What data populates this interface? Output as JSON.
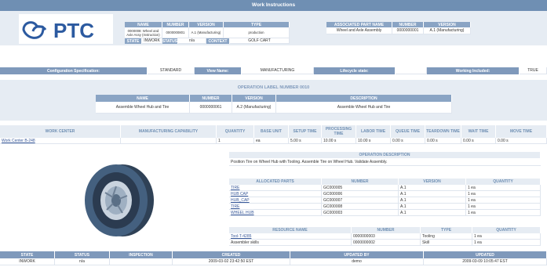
{
  "page_title": "Work Instructions",
  "logo_text": "PTC",
  "header_table": {
    "columns": [
      "NAME",
      "NUMBER",
      "VERSION",
      "TYPE"
    ],
    "row": [
      "0000008: Wheel and Axle Assy (Instruction)",
      "0000000801",
      "A.1 (Manufacturing)",
      "production"
    ],
    "row2_labels": [
      "STATE",
      "INWORK",
      "STATUS",
      "n/a",
      "CONTEXT",
      "GOLF CART"
    ]
  },
  "assoc_table": {
    "columns": [
      "ASSOCIATED PART NAME",
      "NUMBER",
      "VERSION"
    ],
    "row": [
      "Wheel and Axle Assembly",
      "0000000001",
      "A.1 (Manufacturing)"
    ]
  },
  "config_bar": {
    "config_label": "Configuration Specification:",
    "config_value": "STANDARD",
    "view_label": "View Name:",
    "view_value": "MANUFACTURING",
    "lifecycle_label": "Lifecycle state:",
    "lifecycle_value": "",
    "working_label": "Working Included:",
    "working_value": "TRUE"
  },
  "operation": {
    "banner": "OPERATION LABEL NUMBER 0010",
    "columns": [
      "NAME",
      "NUMBER",
      "VERSION",
      "DESCRIPTION"
    ],
    "row": [
      "Assemble Wheel Hub and Tire",
      "0000000061",
      "A.2 (Manufacturing)",
      "Assemble Wheel Hub and Tire"
    ]
  },
  "work_center": {
    "columns": [
      "WORK CENTER",
      "MANUFACTURING CAPABILITY",
      "QUANTITY",
      "BASE UNIT",
      "SETUP TIME",
      "PROCESSING TIME",
      "LABOR TIME",
      "QUEUE TIME",
      "TEARDOWN TIME",
      "WAIT TIME",
      "MOVE TIME"
    ],
    "row": [
      "Work Center B-248",
      "",
      "1",
      "ea",
      "5.00 s",
      "10.00 s",
      "10.00 s",
      "0.00 s",
      "0.00 s",
      "0.00 s",
      "0.00 s"
    ]
  },
  "op_description": {
    "header": "OPERATION DESCRIPTION",
    "text": "Position Tire on Wheel Hub with Tooling. Assemble Tire on Wheel Hub. Validate Assembly."
  },
  "allocated_parts": {
    "columns": [
      "ALLOCATED PARTS",
      "NUMBER",
      "VERSION",
      "QUANTITY"
    ],
    "rows": [
      [
        "TIRE",
        "GC000005",
        "A.1",
        "1 ea"
      ],
      [
        "HUB CAP",
        "GC000006",
        "A.1",
        "1 ea"
      ],
      [
        "HUB_CAP",
        "GC000007",
        "A.1",
        "1 ea"
      ],
      [
        "TIRE",
        "GC000008",
        "A.1",
        "1 ea"
      ],
      [
        "WHEEL HUB",
        "GC000003",
        "A.1",
        "1 ea"
      ]
    ]
  },
  "resources": {
    "columns": [
      "RESOURCE NAME",
      "NUMBER",
      "TYPE",
      "QUANTITY"
    ],
    "rows": [
      [
        "Tool-T-4285",
        "0000000003",
        "Tooling",
        "1 ea"
      ],
      [
        "Assembler skills",
        "0000000002",
        "Skill",
        "1 ea"
      ]
    ]
  },
  "footer": {
    "columns": [
      "STATE",
      "STATUS",
      "INSPECTION",
      "CREATED",
      "UPDATED BY",
      "UPDATED"
    ],
    "row": [
      "INWORK",
      "n/a",
      "",
      "2009-03-02 23:42:50 EST",
      "demo",
      "2009-03-09 10:05:47 EST"
    ]
  },
  "colors": {
    "header_band": "#6f8fb3",
    "header_cell": "#8aa4c4",
    "link": "#3a5a9a",
    "logo": "#2c5aa0"
  }
}
